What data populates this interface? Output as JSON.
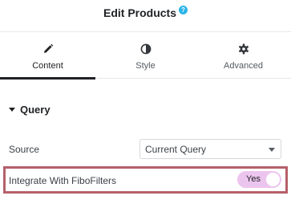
{
  "header": {
    "title": "Edit Products",
    "help_icon": "question-circle-icon",
    "help_symbol": "?"
  },
  "tabs": [
    {
      "label": "Content",
      "icon": "pencil-icon",
      "active": true
    },
    {
      "label": "Style",
      "icon": "half-circle-icon",
      "active": false
    },
    {
      "label": "Advanced",
      "icon": "gear-icon",
      "active": false
    }
  ],
  "section": {
    "title": "Query",
    "expanded": true
  },
  "source": {
    "label": "Source",
    "value": "Current Query"
  },
  "integrate": {
    "label": "Integrate With FiboFilters",
    "toggle_label": "Yes",
    "enabled": true
  },
  "colors": {
    "accent_help": "#2bb5e8",
    "toggle_bg": "#ecc5ee",
    "highlight_border": "#b5606a",
    "active_tab_underline": "#1f2124"
  }
}
